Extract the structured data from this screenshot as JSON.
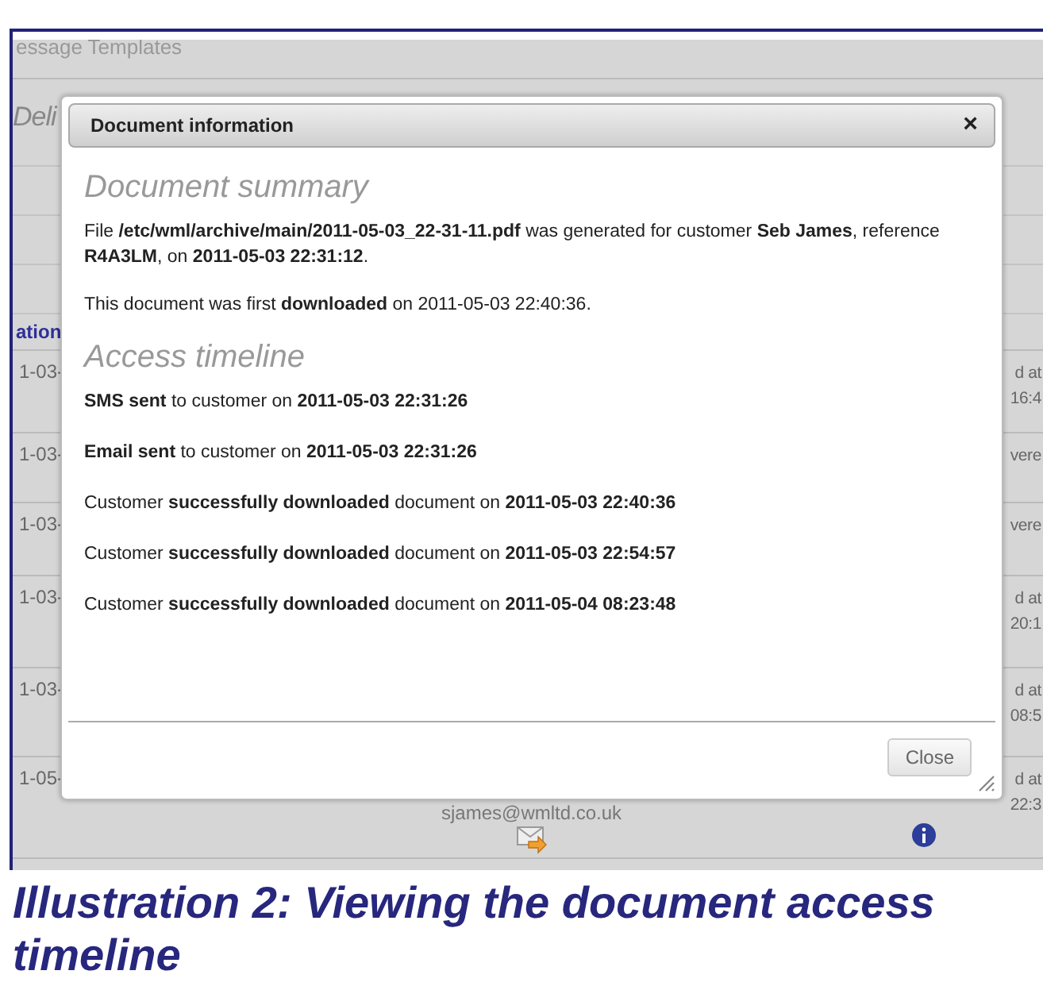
{
  "background_page": {
    "breadcrumb": "essage Templates",
    "title": "Deli",
    "column_header": "ation",
    "rows": [
      {
        "date": "1-03-",
        "status": [
          "d at",
          "16:4"
        ]
      },
      {
        "date": "1-03-",
        "status": [
          "vere"
        ]
      },
      {
        "date": "1-03-",
        "status": [
          "vere"
        ]
      },
      {
        "date": "1-03-",
        "status": [
          "d at",
          "20:1"
        ]
      },
      {
        "date": "1-03-",
        "status": [
          "d at",
          "08:5"
        ]
      },
      {
        "date": "1-05-",
        "status": [
          "d at",
          "22:3"
        ],
        "email": "sjames@wmltd.co.uk"
      }
    ]
  },
  "dialog": {
    "title": "Document information",
    "close_glyph": "×",
    "summary_heading": "Document summary",
    "summary": [
      "File **/etc/wml/archive/main/2011-05-03_22-31-11.pdf** was generated for customer **Seb James**, reference **R4A3LM**, on **2011-05-03 22:31:12**.",
      "This document was first **downloaded** on 2011-05-03 22:40:36."
    ],
    "timeline_heading": "Access timeline",
    "timeline": [
      "**SMS sent** to customer on **2011-05-03 22:31:26**",
      "**Email sent** to customer on **2011-05-03 22:31:26**",
      "Customer **successfully downloaded** document on **2011-05-03 22:40:36**",
      "Customer **successfully downloaded** document on **2011-05-03 22:54:57**",
      "Customer **successfully downloaded** document on **2011-05-04 08:23:48**"
    ],
    "button": "Close"
  },
  "caption": "Illustration 2: Viewing the document access timeline"
}
